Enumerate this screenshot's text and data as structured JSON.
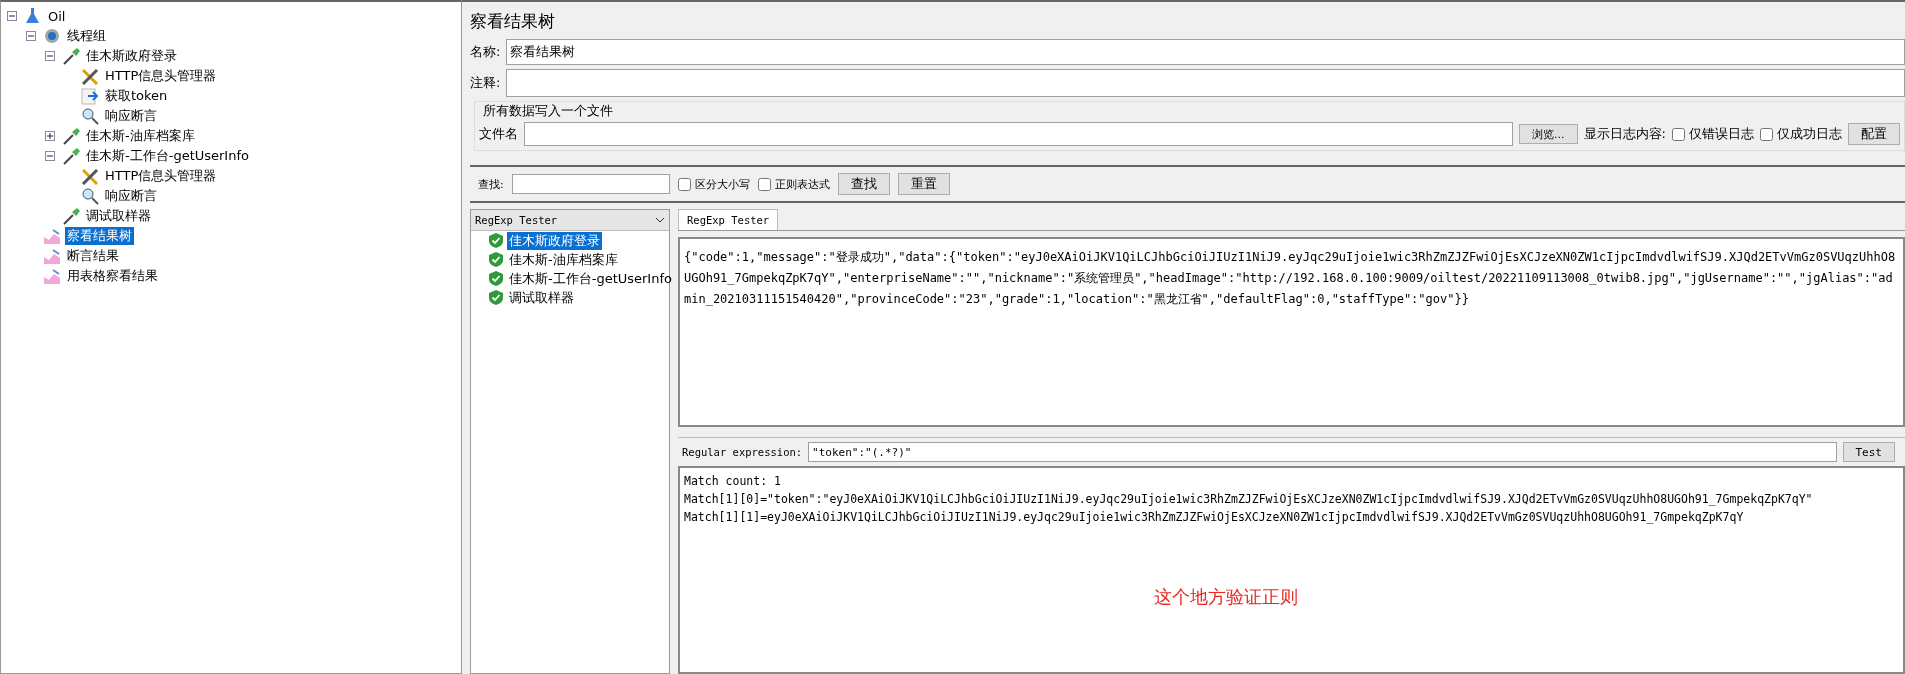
{
  "tree": [
    {
      "label": "Oil",
      "kind": "test-plan",
      "expanded": true,
      "selected": false,
      "children": [
        {
          "label": "线程组",
          "kind": "thread-group",
          "expanded": true,
          "selected": false,
          "children": [
            {
              "label": "佳木斯政府登录",
              "kind": "sampler",
              "expanded": true,
              "selected": false,
              "children": [
                {
                  "label": "HTTP信息头管理器",
                  "kind": "header-manager",
                  "selected": false
                },
                {
                  "label": "获取token",
                  "kind": "extractor",
                  "selected": false
                },
                {
                  "label": "响应断言",
                  "kind": "assertion",
                  "selected": false
                }
              ]
            },
            {
              "label": "佳木斯-油库档案库",
              "kind": "sampler",
              "expanded": false,
              "selected": false
            },
            {
              "label": "佳木斯-工作台-getUserInfo",
              "kind": "sampler",
              "expanded": true,
              "selected": false,
              "children": [
                {
                  "label": "HTTP信息头管理器",
                  "kind": "header-manager",
                  "selected": false
                },
                {
                  "label": "响应断言",
                  "kind": "assertion",
                  "selected": false
                }
              ]
            },
            {
              "label": "调试取样器",
              "kind": "sampler",
              "selected": false
            }
          ]
        },
        {
          "label": "察看结果树",
          "kind": "listener",
          "selected": true
        },
        {
          "label": "断言结果",
          "kind": "listener",
          "selected": false
        },
        {
          "label": "用表格察看结果",
          "kind": "listener",
          "selected": false
        }
      ]
    }
  ],
  "panel": {
    "title": "察看结果树",
    "name_label": "名称:",
    "name_value": "察看结果树",
    "comment_label": "注释:",
    "file_group": {
      "title": "所有数据写入一个文件",
      "file_label": "文件名",
      "browse_button": "浏览...",
      "log_label": "显示日志内容:",
      "log_options": [
        {
          "label": "仅错误日志",
          "checked": false
        },
        {
          "label": "仅成功日志",
          "checked": false
        }
      ],
      "config_button": "配置"
    }
  },
  "search": {
    "label": "查找:",
    "options": [
      {
        "label": "区分大小写",
        "checked": false
      },
      {
        "label": "正则表达式",
        "checked": false
      }
    ],
    "buttons": [
      "查找",
      "重置"
    ]
  },
  "renderer": {
    "value": "RegExp Tester"
  },
  "results": [
    {
      "label": "佳木斯政府登录",
      "selected": true
    },
    {
      "label": "佳木斯-油库档案库",
      "selected": false
    },
    {
      "label": "佳木斯-工作台-getUserInfo",
      "selected": false
    },
    {
      "label": "调试取样器",
      "selected": false
    }
  ],
  "tabs": [
    {
      "label": "RegExp Tester",
      "selected": true
    }
  ],
  "response": "{\"code\":1,\"message\":\"登录成功\",\"data\":{\"token\":\"eyJ0eXAiOiJKV1QiLCJhbGciOiJIUzI1NiJ9.eyJqc29uIjoie1wic3RhZmZJZFwiOjEsXCJzeXN0ZW1cIjpcImdvdlwifSJ9.XJQd2ETvVmGz0SVUqzUhhO8UGOh91_7GmpekqZpK7qY\",\"enterpriseName\":\"\",\"nickname\":\"系统管理员\",\"headImage\":\"http://192.168.0.100:9009/oiltest/20221109113008_0twib8.jpg\",\"jgUsername\":\"\",\"jgAlias\":\"admin_20210311151540420\",\"provinceCode\":\"23\",\"grade\":1,\"location\":\"黑龙江省\",\"defaultFlag\":0,\"staffType\":\"gov\"}}",
  "regex": {
    "label": "Regular expression:",
    "value": "\"token\":\"(.*?)\"",
    "button": "Test"
  },
  "match_lines": [
    "Match count: 1",
    "Match[1][0]=\"token\":\"eyJ0eXAiOiJKV1QiLCJhbGciOiJIUzI1NiJ9.eyJqc29uIjoie1wic3RhZmZJZFwiOjEsXCJzeXN0ZW1cIjpcImdvdlwifSJ9.XJQd2ETvVmGz0SVUqzUhhO8UGOh91_7GmpekqZpK7qY\"",
    "Match[1][1]=eyJ0eXAiOiJKV1QiLCJhbGciOiJIUzI1NiJ9.eyJqc29uIjoie1wic3RhZmZJZFwiOjEsXCJzeXN0ZW1cIjpcImdvdlwifSJ9.XJQd2ETvVmGz0SVUqzUhhO8UGOh91_7GmpekqZpK7qY"
  ],
  "annotation": "这个地方验证正则"
}
